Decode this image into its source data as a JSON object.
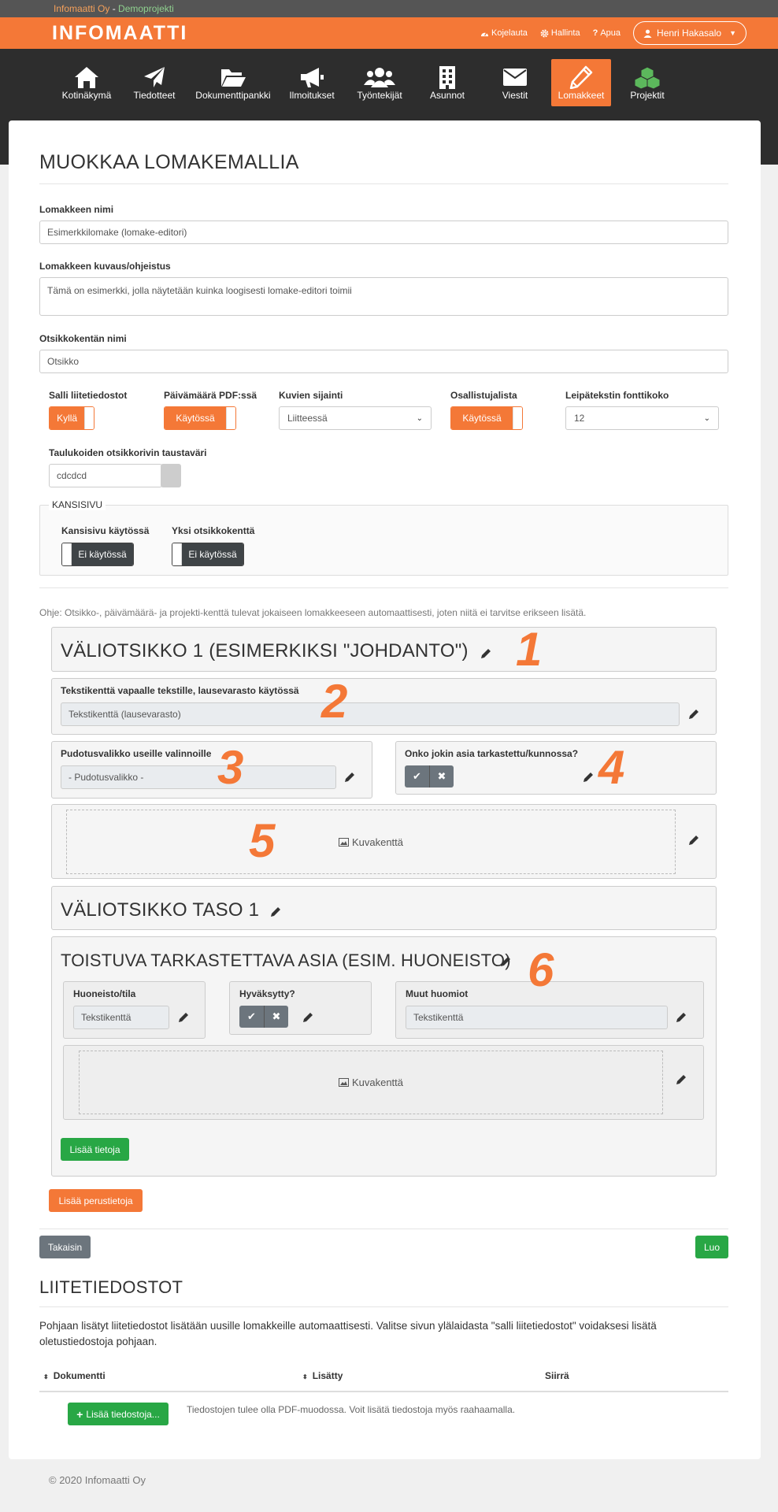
{
  "topstrip": {
    "company": "Infomaatti Oy",
    "separator": " - ",
    "project": "Demoprojekti"
  },
  "brand": {
    "name": "INFOMAATTI"
  },
  "topnav": {
    "dashboard": "Kojelauta",
    "admin": "Hallinta",
    "help": "Apua",
    "user": "Henri Hakasalo"
  },
  "nav": {
    "items": [
      {
        "label": "Kotinäkymä",
        "icon": "home-icon"
      },
      {
        "label": "Tiedotteet",
        "icon": "paper-plane-icon"
      },
      {
        "label": "Dokumenttipankki",
        "icon": "folder-icon"
      },
      {
        "label": "Ilmoitukset",
        "icon": "megaphone-icon"
      },
      {
        "label": "Työntekijät",
        "icon": "users-icon"
      },
      {
        "label": "Asunnot",
        "icon": "building-icon"
      },
      {
        "label": "Viestit",
        "icon": "envelope-icon"
      },
      {
        "label": "Lomakkeet",
        "icon": "pencil-icon"
      },
      {
        "label": "Projektit",
        "icon": "cubes-icon"
      }
    ],
    "active": "Lomakkeet"
  },
  "page": {
    "title": "MUOKKAA LOMAKEMALLIA"
  },
  "form": {
    "name_label": "Lomakkeen nimi",
    "name_value": "Esimerkkilomake (lomake-editori)",
    "desc_label": "Lomakkeen kuvaus/ohjeistus",
    "desc_value": "Tämä on esimerkki, jolla näytetään kuinka loogisesti lomake-editori toimii",
    "title_field_label": "Otsikkokentän nimi",
    "title_field_value": "Otsikko",
    "allow_attachments_label": "Salli liitetiedostot",
    "allow_attachments_value": "Kyllä",
    "date_pdf_label": "Päivämäärä PDF:ssä",
    "date_pdf_value": "Käytössä",
    "image_pos_label": "Kuvien sijainti",
    "image_pos_value": "Liitteessä",
    "participants_label": "Osallistujalista",
    "participants_value": "Käytössä",
    "font_size_label": "Leipätekstin fonttikoko",
    "font_size_value": "12",
    "table_header_color_label": "Taulukoiden otsikkorivin taustaväri",
    "table_header_color_value": "cdcdcd",
    "swatch_color": "#cdcdcd"
  },
  "cover": {
    "legend": "KANSISIVU",
    "cover_enabled_label": "Kansisivu käytössä",
    "cover_enabled_value": "Ei käytössä",
    "single_title_label": "Yksi otsikkokenttä",
    "single_title_value": "Ei käytössä"
  },
  "help_text": "Ohje: Otsikko-, päivämäärä- ja projekti-kenttä tulevat jokaiseen lomakkeeseen automaattisesti, joten niitä ei tarvitse erikseen lisätä.",
  "blocks": {
    "heading1": "VÄLIOTSIKKO 1 (ESIMERKIKSI \"JOHDANTO\")",
    "text_label": "Tekstikenttä vapaalle tekstille, lausevarasto käytössä",
    "text_placeholder": "Tekstikenttä (lausevarasto)",
    "dropdown_label": "Pudotusvalikko useille valinnoille",
    "dropdown_placeholder": "- Pudotusvalikko -",
    "check_label": "Onko jokin asia tarkastettu/kunnossa?",
    "image_field": "Kuvakenttä",
    "subheading": "VÄLIOTSIKKO TASO 1",
    "repeat_heading": "TOISTUVA TARKASTETTAVA ASIA (ESIM. HUONEISTO)",
    "room_label": "Huoneisto/tila",
    "room_placeholder": "Tekstikenttä",
    "approved_label": "Hyväksytty?",
    "notes_label": "Muut huomiot",
    "notes_placeholder": "Tekstikenttä",
    "repeat_image_field": "Kuvakenttä",
    "add_info_button": "Lisää tietoja",
    "add_basic_button": "Lisää perustietoja"
  },
  "annotations": [
    "1",
    "2",
    "3",
    "4",
    "5",
    "6"
  ],
  "actions": {
    "back": "Takaisin",
    "create": "Luo"
  },
  "attachments": {
    "title": "LIITETIEDOSTOT",
    "description": "Pohjaan lisätyt liitetiedostot lisätään uusille lomakkeille automaattisesti. Valitse sivun ylälaidasta \"salli liitetiedostot\" voidaksesi lisätä oletustiedostoja pohjaan.",
    "col_document": "Dokumentti",
    "col_added": "Lisätty",
    "col_move": "Siirrä",
    "add_button": "Lisää tiedostoja...",
    "note": "Tiedostojen tulee olla PDF-muodossa. Voit lisätä tiedostoja myös raahaamalla."
  },
  "footer": {
    "copyright": "© 2020 Infomaatti Oy"
  },
  "colors": {
    "accent": "#f47837",
    "dark": "#2d2d2d",
    "success": "#28a745",
    "projekti_icon": "#5cb85c"
  }
}
